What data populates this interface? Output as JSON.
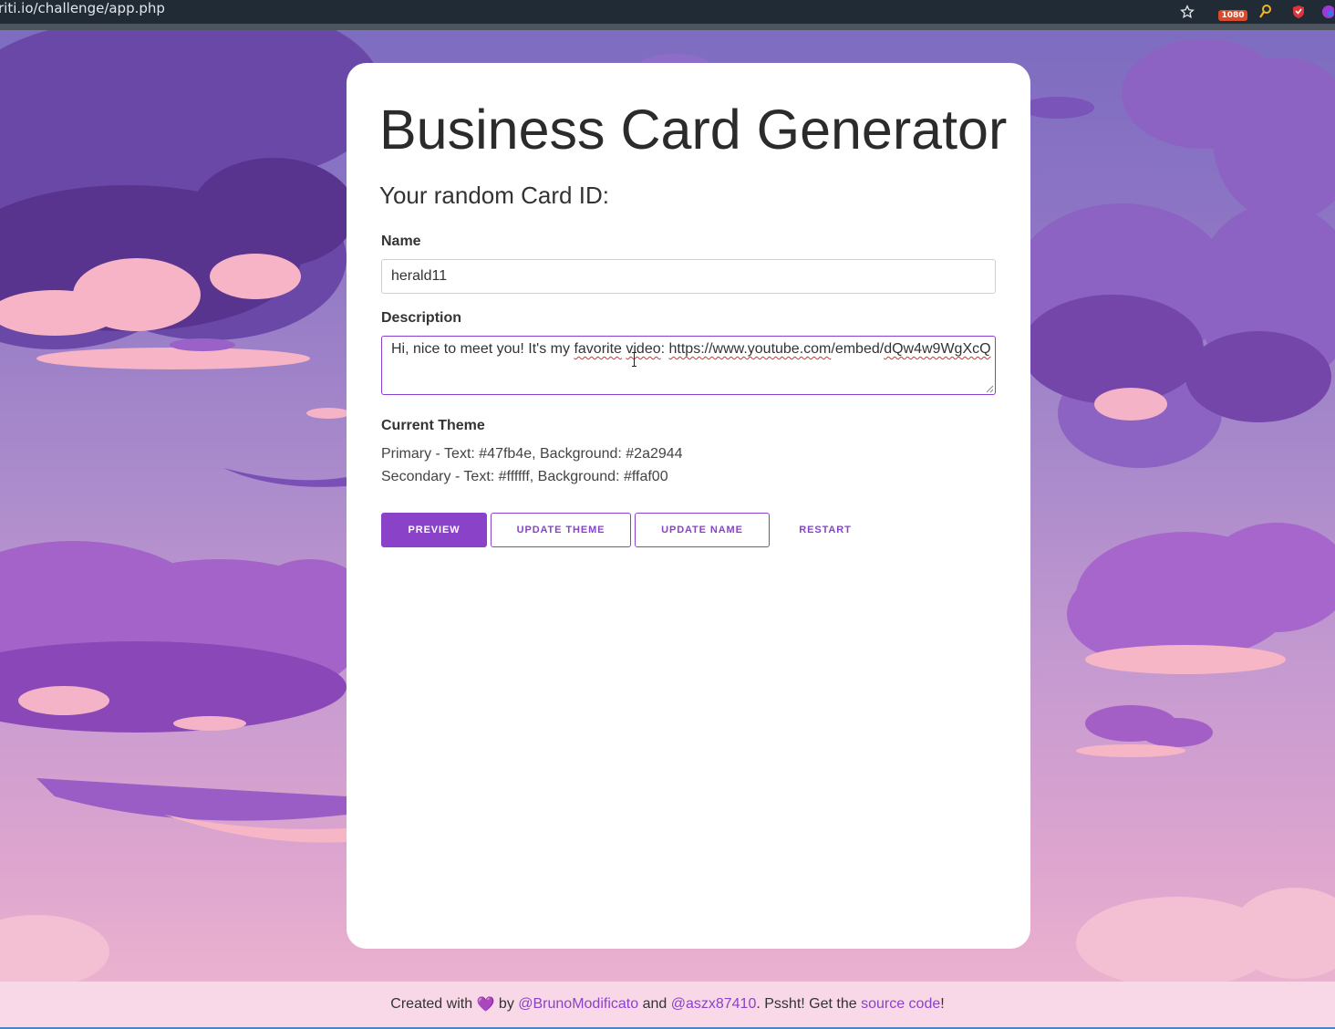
{
  "browser": {
    "url": "riti.io/challenge/app.php",
    "extension_badge": "1080"
  },
  "card": {
    "title": "Business Card Generator",
    "subtitle": "Your random Card ID:",
    "name_label": "Name",
    "name_value": "herald11",
    "description_label": "Description",
    "description_value": {
      "part1": "Hi, nice to meet you! It's my ",
      "word1": "favorite",
      "part2": " ",
      "word2": "video",
      "part3": ": ",
      "word3": "https://www.youtube.com",
      "part4": "/embed/",
      "word4": "dQw4w9WgXcQ"
    },
    "theme_label": "Current Theme",
    "theme_primary": "Primary - Text: #47fb4e, Background: #2a2944",
    "theme_secondary": "Secondary - Text: #ffffff, Background: #ffaf00",
    "buttons": {
      "preview": "PREVIEW",
      "update_theme": "UPDATE THEME",
      "update_name": "UPDATE NAME",
      "restart": "RESTART"
    }
  },
  "footer": {
    "prefix": "Created with ",
    "heart": "💜",
    "by": " by ",
    "author1": "@BrunoModificato",
    "and": " and ",
    "author2": "@aszx87410",
    "middle": ". Pssht! Get the ",
    "source_link": "source code",
    "suffix": "!"
  },
  "colors": {
    "accent": "#8a43c8",
    "card_bg": "#ffffff",
    "browser_bar": "#202b35"
  }
}
